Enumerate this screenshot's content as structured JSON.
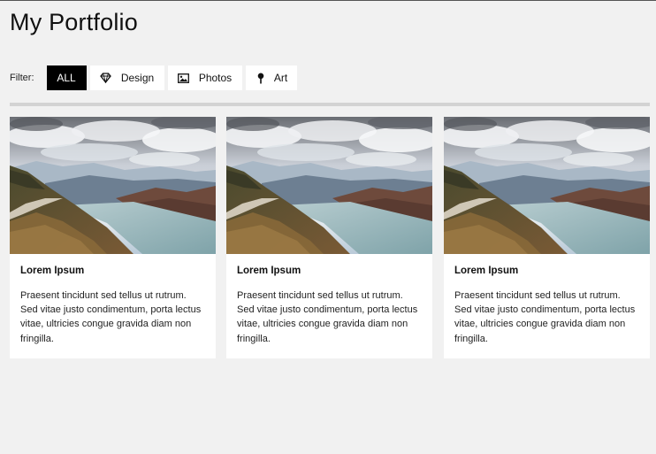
{
  "header": {
    "title": "My Portfolio"
  },
  "filter": {
    "label": "Filter:",
    "buttons": [
      {
        "label": "ALL",
        "icon": "",
        "active": true
      },
      {
        "label": "Design",
        "icon": "diamond-icon",
        "active": false
      },
      {
        "label": "Photos",
        "icon": "photo-icon",
        "active": false
      },
      {
        "label": "Art",
        "icon": "map-pin-icon",
        "active": false
      }
    ]
  },
  "cards": [
    {
      "image": "landscape-photo",
      "title": "Lorem Ipsum",
      "text": "Praesent tincidunt sed tellus ut rutrum. Sed vitae justo condimentum, porta lectus vitae, ultricies congue gravida diam non fringilla."
    },
    {
      "image": "landscape-photo",
      "title": "Lorem Ipsum",
      "text": "Praesent tincidunt sed tellus ut rutrum. Sed vitae justo condimentum, porta lectus vitae, ultricies congue gravida diam non fringilla."
    },
    {
      "image": "landscape-photo",
      "title": "Lorem Ipsum",
      "text": "Praesent tincidunt sed tellus ut rutrum. Sed vitae justo condimentum, porta lectus vitae, ultricies congue gravida diam non fringilla."
    }
  ],
  "colors": {
    "background": "#f1f1f1",
    "active_button": "#000000",
    "card": "#ffffff",
    "divider": "#d3d3d3"
  }
}
